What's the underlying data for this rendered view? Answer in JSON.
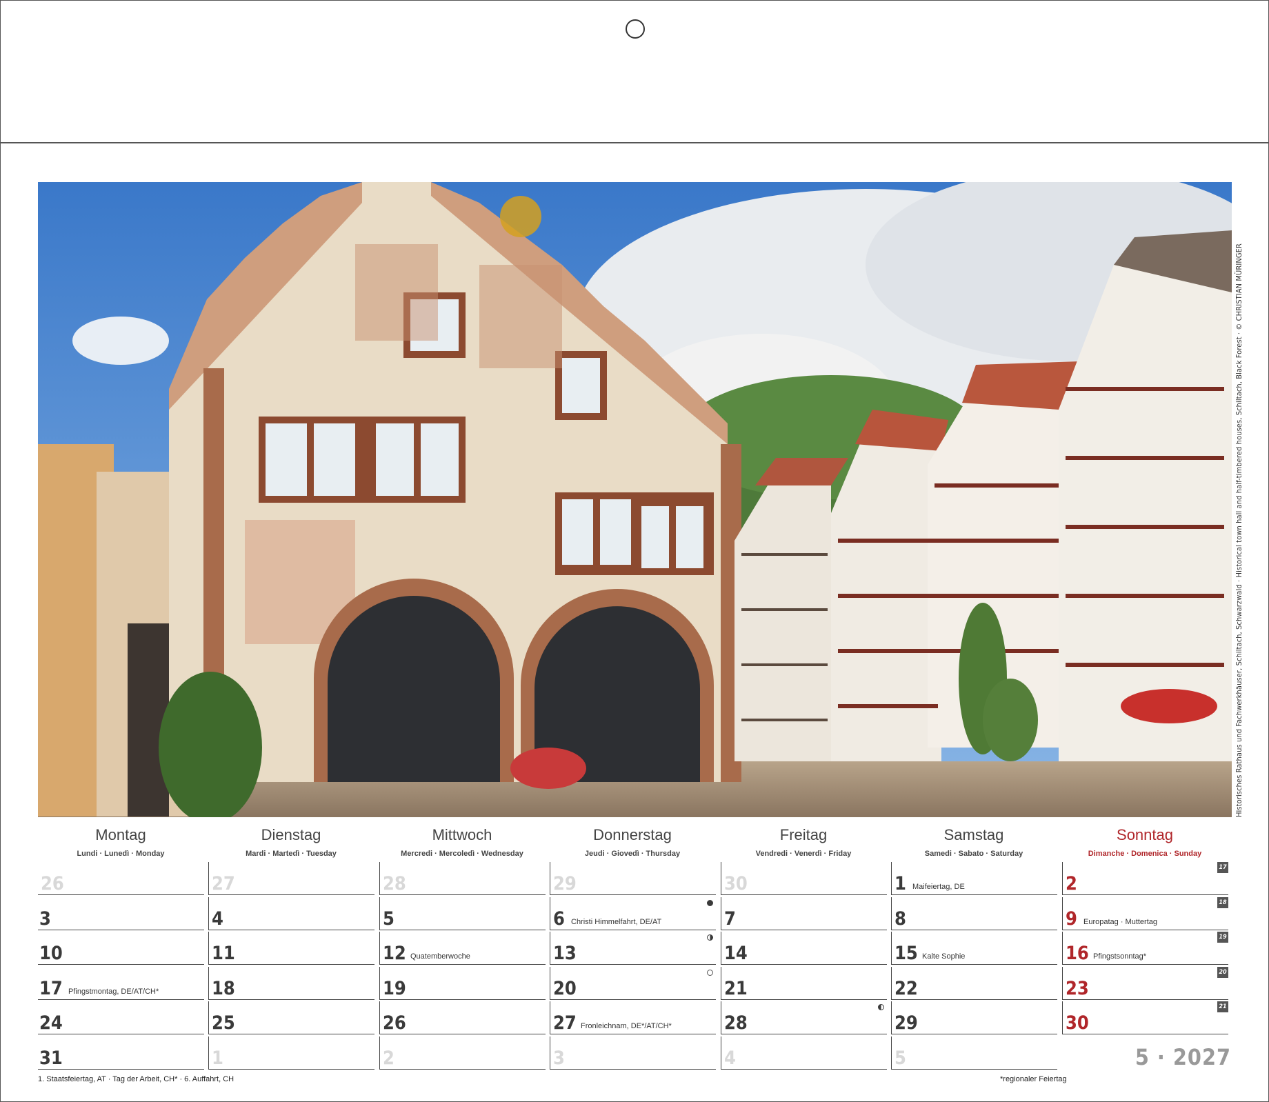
{
  "photo_credit": "Historisches Rathaus und Fachwerkhäuser, Schiltach, Schwarzwald · Historical town hall and half-timbered houses, Schiltach, Black Forest · © CHRISTIAN MÜRINGER",
  "weekdays": [
    {
      "name": "Montag",
      "sub": "Lundi · Lunedì · Monday"
    },
    {
      "name": "Dienstag",
      "sub": "Mardi · Martedì · Tuesday"
    },
    {
      "name": "Mittwoch",
      "sub": "Mercredi · Mercoledì · Wednesday"
    },
    {
      "name": "Donnerstag",
      "sub": "Jeudi · Giovedì · Thursday"
    },
    {
      "name": "Freitag",
      "sub": "Vendredi · Venerdì · Friday"
    },
    {
      "name": "Samstag",
      "sub": "Samedi · Sabato · Saturday"
    },
    {
      "name": "Sonntag",
      "sub": "Dimanche · Domenica · Sunday"
    }
  ],
  "weeks": [
    {
      "kw": "17",
      "days": [
        {
          "n": "26",
          "style": "light"
        },
        {
          "n": "27",
          "style": "light"
        },
        {
          "n": "28",
          "style": "light"
        },
        {
          "n": "29",
          "style": "light"
        },
        {
          "n": "30",
          "style": "light"
        },
        {
          "n": "1",
          "note": "Maifeiertag, DE"
        },
        {
          "n": "2",
          "style": "red"
        }
      ]
    },
    {
      "kw": "18",
      "days": [
        {
          "n": "3"
        },
        {
          "n": "4"
        },
        {
          "n": "5"
        },
        {
          "n": "6",
          "note": "Christi Himmelfahrt, DE/AT",
          "moon": "full"
        },
        {
          "n": "7"
        },
        {
          "n": "8"
        },
        {
          "n": "9",
          "style": "red",
          "note": "Europatag · Muttertag"
        }
      ]
    },
    {
      "kw": "19",
      "days": [
        {
          "n": "10"
        },
        {
          "n": "11"
        },
        {
          "n": "12",
          "note": "Quatemberwoche"
        },
        {
          "n": "13",
          "moon": "half"
        },
        {
          "n": "14"
        },
        {
          "n": "15",
          "note": "Kalte Sophie"
        },
        {
          "n": "16",
          "style": "red",
          "note": "Pfingstsonntag*"
        }
      ]
    },
    {
      "kw": "20",
      "days": [
        {
          "n": "17",
          "note": "Pfingstmontag, DE/AT/CH*"
        },
        {
          "n": "18"
        },
        {
          "n": "19"
        },
        {
          "n": "20",
          "moon": "new"
        },
        {
          "n": "21"
        },
        {
          "n": "22"
        },
        {
          "n": "23",
          "style": "red"
        }
      ]
    },
    {
      "kw": "21",
      "days": [
        {
          "n": "24"
        },
        {
          "n": "25"
        },
        {
          "n": "26"
        },
        {
          "n": "27",
          "note": "Fronleichnam, DE*/AT/CH*"
        },
        {
          "n": "28",
          "moon": "halfl"
        },
        {
          "n": "29"
        },
        {
          "n": "30",
          "style": "red"
        }
      ]
    },
    {
      "kw": "",
      "days": [
        {
          "n": "31"
        },
        {
          "n": "1",
          "style": "light"
        },
        {
          "n": "2",
          "style": "light"
        },
        {
          "n": "3",
          "style": "light"
        },
        {
          "n": "4",
          "style": "light"
        },
        {
          "n": "5",
          "style": "light"
        }
      ]
    }
  ],
  "month_year": "5 · 2027",
  "footnote_left": "1. Staatsfeiertag, AT  ·  Tag der Arbeit, CH*  ·  6. Auffahrt, CH",
  "footnote_right": "*regionaler Feiertag"
}
